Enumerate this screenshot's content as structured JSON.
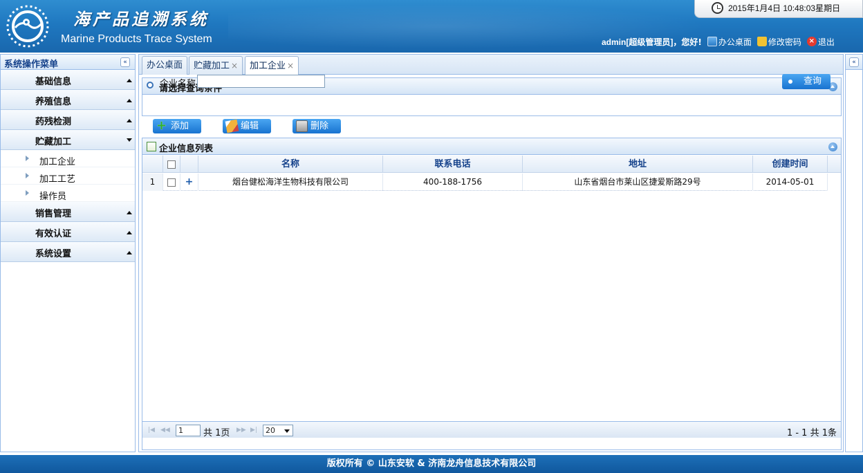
{
  "header": {
    "title_cn": "海产品追溯系统",
    "title_en": "Marine Products Trace System",
    "datetime": "2015年1月4日  10:48:03星期日",
    "user": "admin[超级管理员]，",
    "greeting": "您好!",
    "links": {
      "desktop": "办公桌面",
      "change_password": "修改密码",
      "logout": "退出"
    }
  },
  "sidebar": {
    "title": "系统操作菜单",
    "sections": [
      {
        "label": "基础信息"
      },
      {
        "label": "养殖信息"
      },
      {
        "label": "药残检测"
      },
      {
        "label": "贮藏加工",
        "children": [
          "加工企业",
          "加工工艺",
          "操作员"
        ]
      },
      {
        "label": "销售管理"
      },
      {
        "label": "有效认证"
      },
      {
        "label": "系统设置"
      }
    ]
  },
  "tabs": [
    {
      "label": "办公桌面"
    },
    {
      "label": "贮藏加工"
    },
    {
      "label": "加工企业"
    }
  ],
  "tab_close": "×",
  "query": {
    "panel_title": "请选择查询条件",
    "field_label": "企业名称",
    "field_value": "",
    "search_button": "查询"
  },
  "toolbar": {
    "add": "添加",
    "edit": "编辑",
    "delete": "删除"
  },
  "list": {
    "panel_title": "企业信息列表",
    "columns": [
      "名称",
      "联系电话",
      "地址",
      "创建时间"
    ],
    "rows": [
      {
        "num": "1",
        "expand": "+",
        "name": "烟台健松海洋生物科技有限公司",
        "phone": "400-188-1756",
        "address": "山东省烟台市莱山区捷爱斯路29号",
        "created": "2014-05-01"
      }
    ]
  },
  "pager": {
    "page": "1",
    "total_pages": "共 1页",
    "page_size": "20",
    "info": "1 - 1   共 1条"
  },
  "footer": "版权所有  ©  山东安软  & 济南龙舟信息技术有限公司",
  "colors": {
    "header_blue": "#1f78c0",
    "border_blue": "#99bbe8",
    "button_blue": "#1873d0",
    "footer_blue": "#10589e"
  }
}
